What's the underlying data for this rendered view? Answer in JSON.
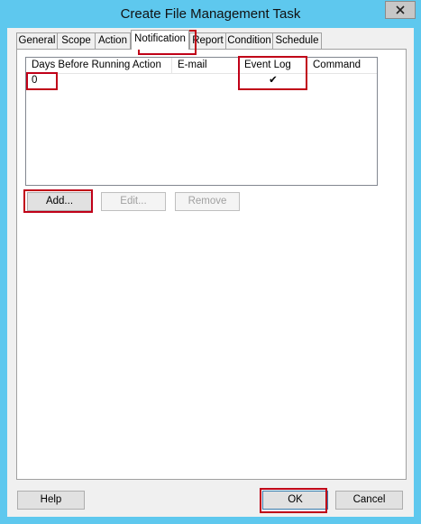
{
  "window": {
    "title": "Create File Management Task",
    "close_icon": "close-icon"
  },
  "tabs": [
    {
      "label": "General",
      "active": false
    },
    {
      "label": "Scope",
      "active": false
    },
    {
      "label": "Action",
      "active": false
    },
    {
      "label": "Notification",
      "active": true
    },
    {
      "label": "Report",
      "active": false
    },
    {
      "label": "Condition",
      "active": false
    },
    {
      "label": "Schedule",
      "active": false
    }
  ],
  "notification_list": {
    "columns": [
      "Days Before Running Action",
      "E-mail",
      "Event Log",
      "Command"
    ],
    "rows": [
      {
        "days": "0",
        "email": "",
        "event_log": "✔",
        "command": ""
      }
    ]
  },
  "list_buttons": {
    "add": "Add...",
    "edit": "Edit...",
    "remove": "Remove"
  },
  "footer": {
    "help": "Help",
    "ok": "OK",
    "cancel": "Cancel"
  },
  "colors": {
    "title_bar": "#5ec8ee",
    "highlight": "#c00018"
  }
}
